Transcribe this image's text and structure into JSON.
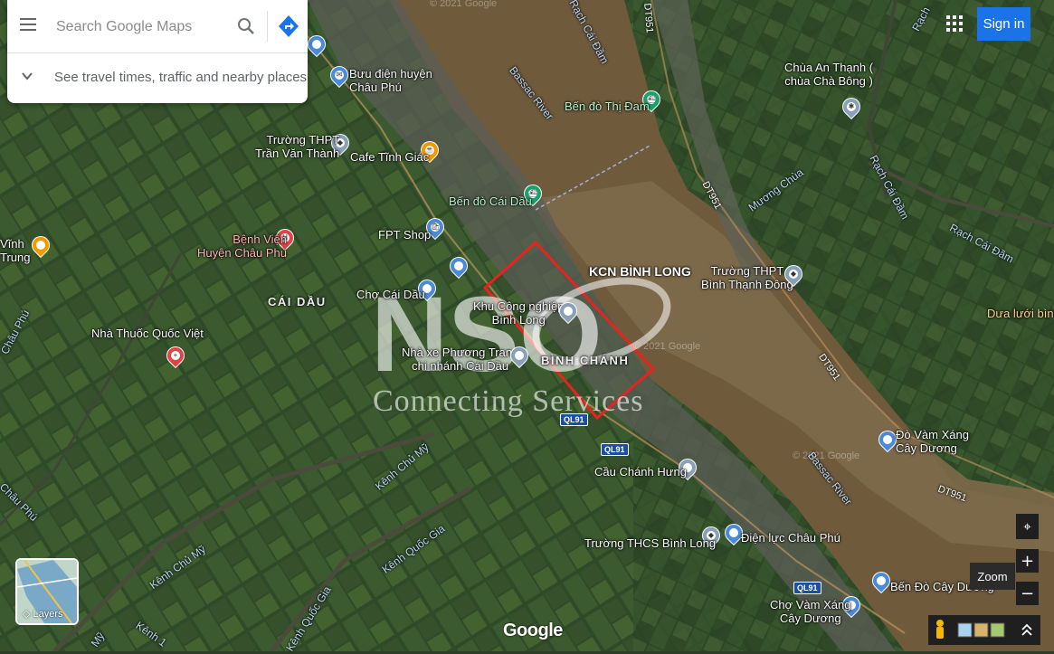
{
  "search": {
    "placeholder": "Search Google Maps",
    "travel_hint": "See travel times, traffic and nearby places"
  },
  "header": {
    "sign_in": "Sign in"
  },
  "places": {
    "buu_dien_1": "Bưu điện huyện",
    "buu_dien_2": "Châu Phú",
    "thpt_tvt_1": "Trường THPT",
    "thpt_tvt_2": "Trần Văn Thành",
    "cafe": "Cafe Tĩnh Giác",
    "ben_do_cai_dau": "Bến đò Cái Dầu",
    "fpt": "FPT Shop",
    "benh_vien_1": "Bệnh Viện",
    "benh_vien_2": "Huyện Châu Phú",
    "cho_cai_dau": "Chợ Cái Dầu",
    "nha_thuoc": "Nhà Thuốc Quốc Việt",
    "khu_cn_1": "Khu Công nghiệp",
    "khu_cn_2": "Bình Long",
    "nha_xe_1": "Nhà xe Phương Trang",
    "nha_xe_2": "chi nhánh Cái Dầu",
    "ben_do_thi_dam": "Bến đò Thị Đam",
    "chua_1": "Chùa An Thạnh (",
    "chua_2": "chùa Chà Bông )",
    "thpt_btd_1": "Trường THPT",
    "thpt_btd_2": "Bình Thạnh Đông",
    "dua_luoi": "Dưa lưới bình",
    "do_vam_xang_1": "Đò Vàm Xáng",
    "do_vam_xang_2": "Cây Dương",
    "cau_chanh_hung": "Cầu Chánh Hưng",
    "thcs": "Trường THCS Bình Long",
    "dien_luc": "Điện lực Châu Phú",
    "ben_do_cay_duong": "Bến Đò Cây Dương",
    "cho_vam_xang_1": "Chợ Vàm Xáng",
    "cho_vam_xang_2": "Cây Dương",
    "vinh_1": "Vĩnh",
    "vinh_2": "Trung"
  },
  "areas": {
    "cai_dau": "CÁI DẦU",
    "binh_chanh": "BÌNH CHÁNH"
  },
  "water": {
    "bassac_1": "Bassac River",
    "bassac_2": "Bassac River",
    "rach_cai_dam_1": "Rạch Cái Đầm",
    "rach_cai_dam_2": "Rạch Cái Đầm",
    "rach_cai_dam_3": "Rạch Cái Đầm",
    "rach_top": "Rạch",
    "muong_chua": "Mương Chùa",
    "kenh_chu_my_1": "Kênh Chủ Mỹ",
    "kenh_chu_my_2": "Kênh Chủ Mỹ",
    "kenh_quoc_gia_1": "Kênh Quốc Gia",
    "kenh_quoc_gia_2": "Kênh Quốc Gia",
    "chau_phu": "Châu Phú",
    "chau_phu_2": "Châu Phú",
    "kenh_1": "Kênh 1",
    "my": "Mỹ"
  },
  "roads": {
    "dt951": "DT951",
    "ql91": "QL91"
  },
  "overlay": {
    "kcn": "KCN BÌNH LONG",
    "watermark": "Connecting Services",
    "watermark_logo": "NSO"
  },
  "controls": {
    "layers": "Layers",
    "zoom_tip": "Zoom",
    "zoom_in": "+",
    "zoom_out": "−",
    "google": "Google",
    "copyright": "© 2021 Google"
  },
  "colors": {
    "accent": "#1a73e8",
    "boundary": "#e8231f",
    "directions": "#1a73e8"
  }
}
